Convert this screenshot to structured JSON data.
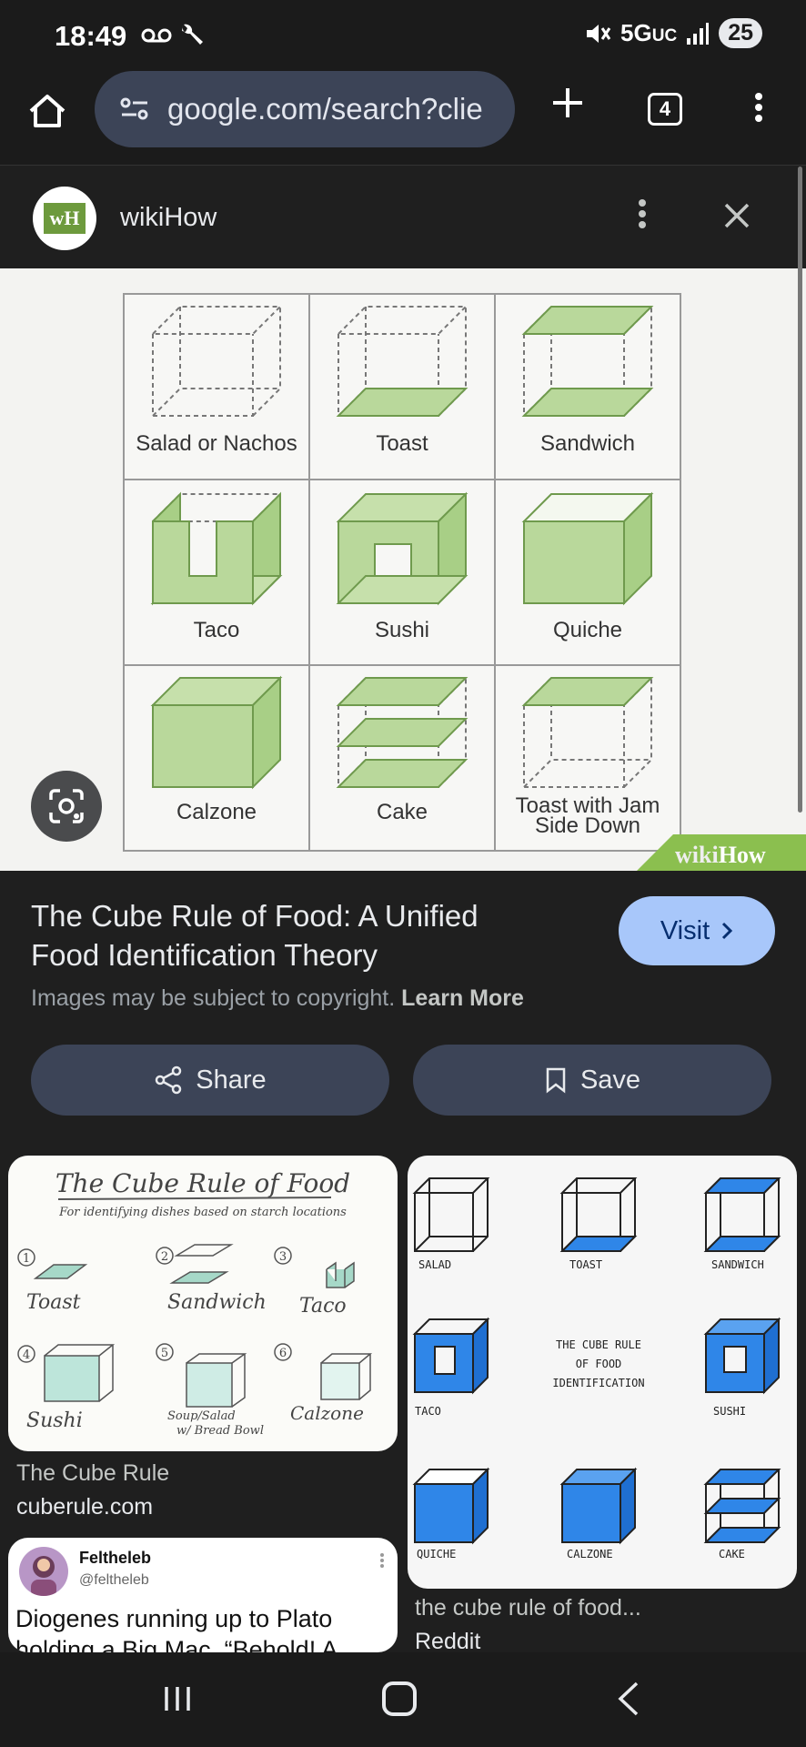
{
  "status": {
    "time": "18:49",
    "network": "5G",
    "network_suffix": "UC",
    "battery": "25"
  },
  "toolbar": {
    "url": "google.com/search?clie",
    "tabs_count": "4"
  },
  "viewer": {
    "site_name": "wikiHow",
    "logo_text": "wH"
  },
  "main_image": {
    "cells": [
      "Salad or Nachos",
      "Toast",
      "Sandwich",
      "Taco",
      "Sushi",
      "Quiche",
      "Calzone",
      "Cake",
      "Toast with Jam",
      "Side Down"
    ],
    "watermark_a": "wiki",
    "watermark_b": "How"
  },
  "result": {
    "title": "The Cube Rule of Food: A Unified Food Identification Theory",
    "visit_label": "Visit",
    "copyright_text": "Images may be subject to copyright.",
    "learn_more": "Learn More",
    "share_label": "Share",
    "save_label": "Save"
  },
  "related": [
    {
      "title": "The Cube Rule",
      "source": "cuberule.com",
      "image_title": "The Cube Rule of Food",
      "image_subtitle": "For identifying dishes based on starch locations",
      "items": [
        "Toast",
        "Sandwich",
        "Taco",
        "Sushi",
        "Soup/Salad",
        "w/ Bread Bowl",
        "Calzone"
      ],
      "numbers": [
        "1",
        "2",
        "3",
        "4",
        "5",
        "6"
      ]
    },
    {
      "title": "the cube rule of food...",
      "source": "Reddit",
      "items": [
        "SALAD",
        "TOAST",
        "SANDWICH",
        "TACO",
        "SUSHI",
        "QUICHE",
        "CALZONE",
        "CAKE"
      ],
      "center_text": [
        "THE CUBE RULE",
        "OF FOOD",
        "IDENTIFICATION"
      ]
    },
    {
      "name": "Feltheleb",
      "handle": "@feltheleb",
      "text": "Diogenes running up to Plato holding a Big Mac. “Behold! A"
    }
  ],
  "colors": {
    "accent": "#a8c7fa",
    "chip": "#3c4457",
    "cube_green": "#b9d89b",
    "cube_blue": "#2f86e8"
  }
}
